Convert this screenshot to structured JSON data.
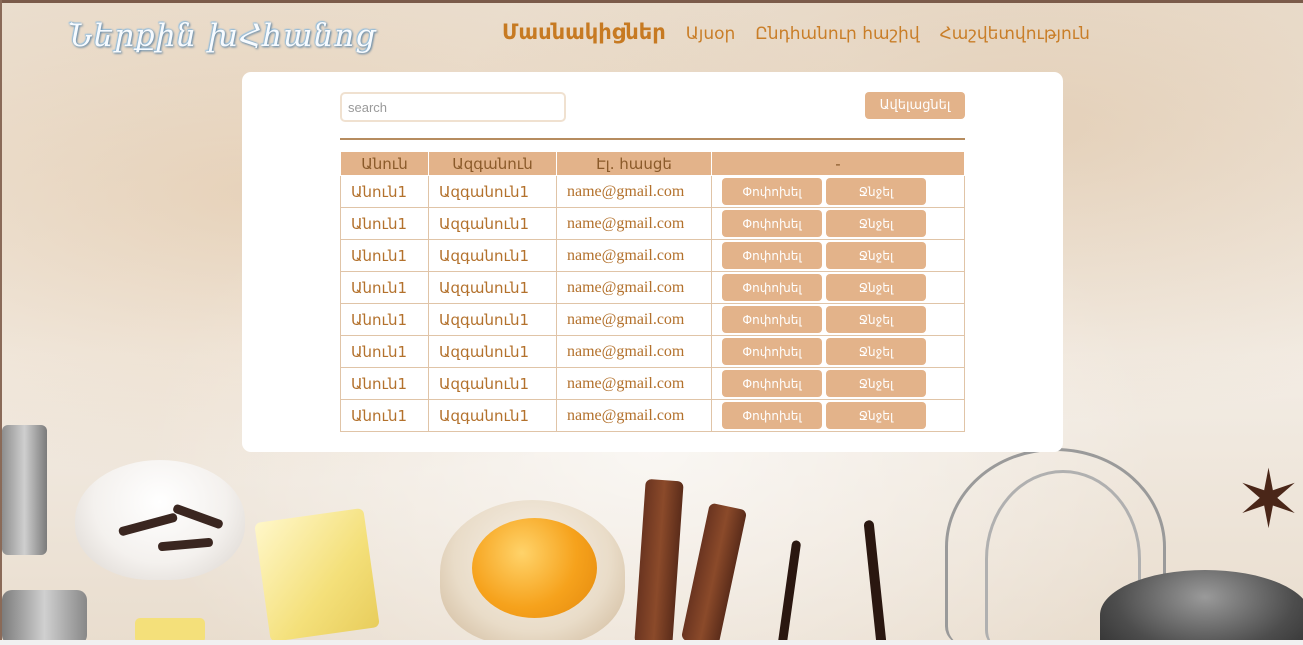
{
  "header": {
    "logo": "Ներքին խՀհանոց",
    "nav": [
      {
        "label": "Մասնակիցներ",
        "active": true
      },
      {
        "label": "Այսօր",
        "active": false
      },
      {
        "label": "Ընդհանուր հաշիվ",
        "active": false
      },
      {
        "label": "Հաշվետվություն",
        "active": false
      }
    ]
  },
  "toolbar": {
    "search_placeholder": "search",
    "add_label": "Ավելացնել"
  },
  "table": {
    "columns": [
      "Անուն",
      "Ազգանուն",
      "Էլ. հասցե",
      "-"
    ],
    "rows": [
      {
        "name": "Անուն1",
        "surname": "Ազգանուն1",
        "email": "name@gmail.com",
        "edit": "Փոփոխել",
        "delete": "Ջնջել"
      },
      {
        "name": "Անուն1",
        "surname": "Ազգանուն1",
        "email": "name@gmail.com",
        "edit": "Փոփոխել",
        "delete": "Ջնջել"
      },
      {
        "name": "Անուն1",
        "surname": "Ազգանուն1",
        "email": "name@gmail.com",
        "edit": "Փոփոխել",
        "delete": "Ջնջել"
      },
      {
        "name": "Անուն1",
        "surname": "Ազգանուն1",
        "email": "name@gmail.com",
        "edit": "Փոփոխել",
        "delete": "Ջնջել"
      },
      {
        "name": "Անուն1",
        "surname": "Ազգանուն1",
        "email": "name@gmail.com",
        "edit": "Փոփոխել",
        "delete": "Ջնջել"
      },
      {
        "name": "Անուն1",
        "surname": "Ազգանուն1",
        "email": "name@gmail.com",
        "edit": "Փոփոխել",
        "delete": "Ջնջել"
      },
      {
        "name": "Անուն1",
        "surname": "Ազգանուն1",
        "email": "name@gmail.com",
        "edit": "Փոփոխել",
        "delete": "Ջնջել"
      },
      {
        "name": "Անուն1",
        "surname": "Ազգանուն1",
        "email": "name@gmail.com",
        "edit": "Փոփոխել",
        "delete": "Ջնջել"
      }
    ]
  },
  "colors": {
    "accent": "#e3b38a",
    "nav_text": "#c97e28",
    "cell_text": "#b3712c",
    "divider": "#b68c5f"
  }
}
